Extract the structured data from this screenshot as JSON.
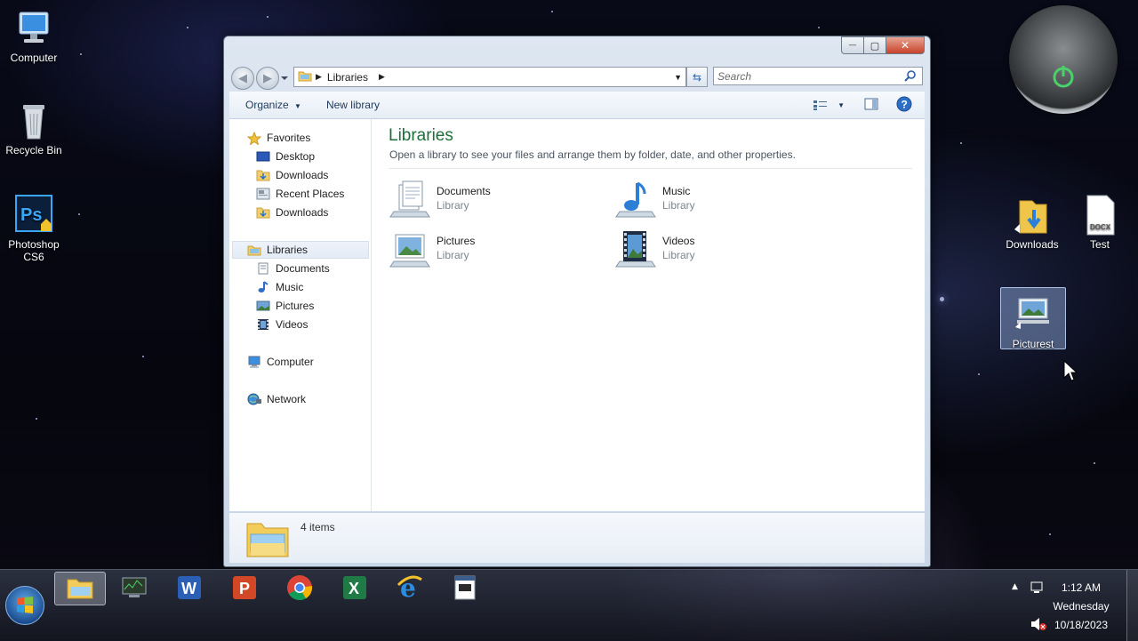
{
  "desktop": {
    "left_icons": [
      {
        "label": "Computer"
      },
      {
        "label": "Recycle Bin"
      },
      {
        "label": "Photoshop CS6"
      }
    ],
    "right_icons": [
      {
        "label": "Downloads"
      },
      {
        "label": "Test"
      },
      {
        "label": "Picturest"
      }
    ],
    "docx_badge": "DOCX",
    "ps_badge": "Ps"
  },
  "window": {
    "caption": {
      "minimize": "—",
      "maximize": "▢",
      "close": "✕"
    },
    "address": {
      "path": "Libraries"
    },
    "search": {
      "placeholder": "Search"
    },
    "toolbar": {
      "organize": "Organize",
      "new_library": "New library"
    },
    "nav": {
      "favorites": "Favorites",
      "favorites_items": [
        "Desktop",
        "Downloads",
        "Recent Places",
        "Downloads"
      ],
      "libraries": "Libraries",
      "libraries_items": [
        "Documents",
        "Music",
        "Pictures",
        "Videos"
      ],
      "computer": "Computer",
      "network": "Network"
    },
    "main": {
      "title": "Libraries",
      "subtitle": "Open a library to see your files and arrange them by folder, date, and other properties.",
      "libraries": [
        {
          "name": "Documents",
          "type": "Library"
        },
        {
          "name": "Music",
          "type": "Library"
        },
        {
          "name": "Pictures",
          "type": "Library"
        },
        {
          "name": "Videos",
          "type": "Library"
        }
      ]
    },
    "status": {
      "count": "4 items"
    }
  },
  "taskbar": {
    "clock": {
      "time": "1:12 AM",
      "day": "Wednesday",
      "date": "10/18/2023"
    }
  },
  "colors": {
    "accent": "#1e6e3a",
    "link": "#1e395b"
  }
}
